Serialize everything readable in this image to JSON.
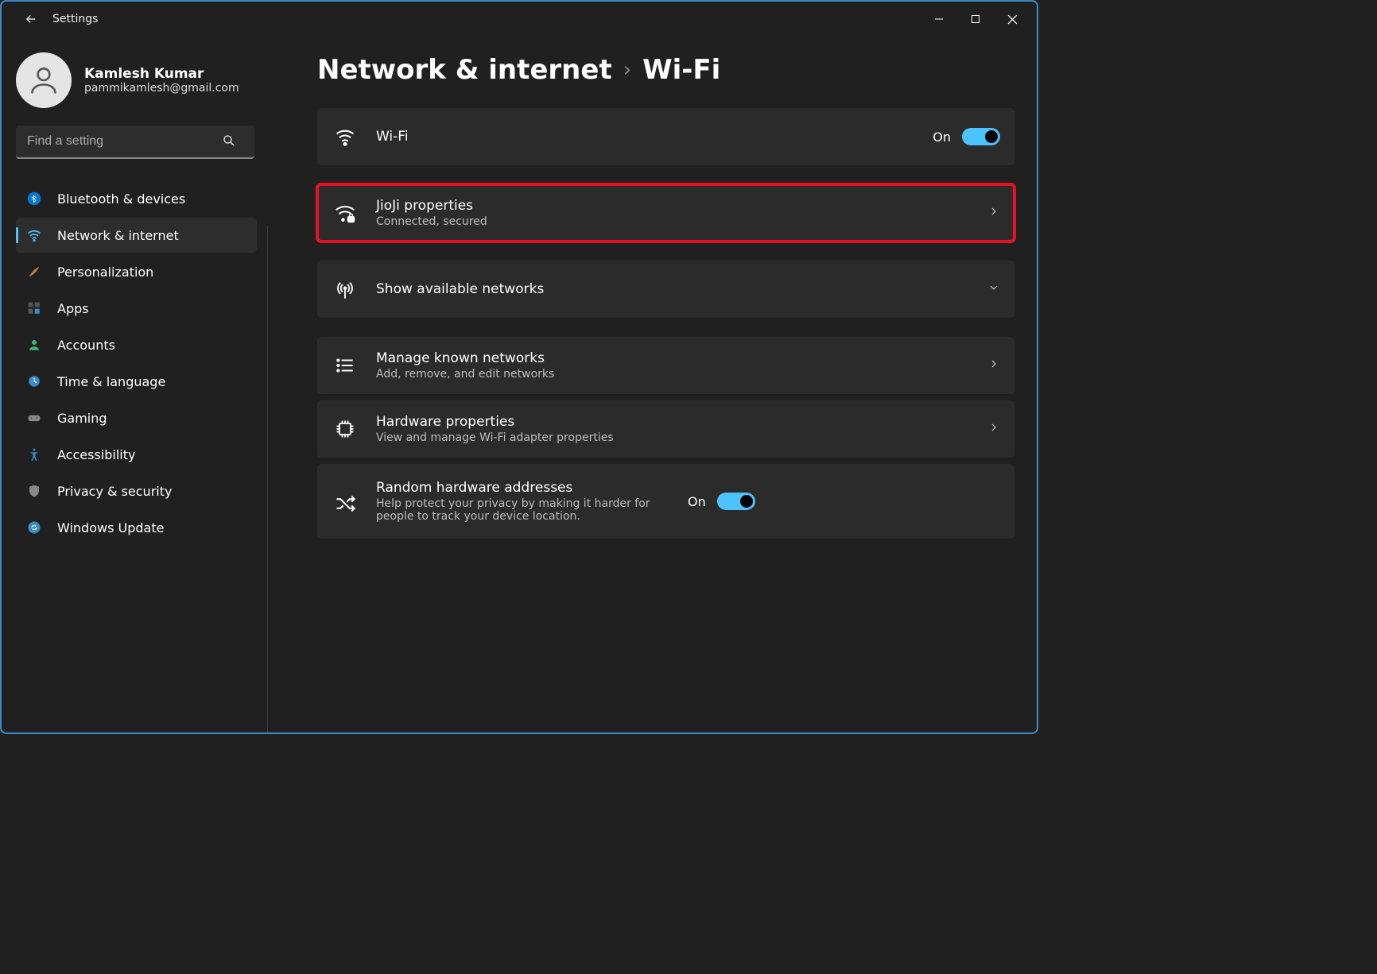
{
  "titlebar": {
    "app_title": "Settings"
  },
  "profile": {
    "name": "Kamlesh Kumar",
    "email": "pammikamlesh@gmail.com"
  },
  "search": {
    "placeholder": "Find a setting"
  },
  "nav": {
    "items": [
      {
        "label": "Bluetooth & devices"
      },
      {
        "label": "Network & internet"
      },
      {
        "label": "Personalization"
      },
      {
        "label": "Apps"
      },
      {
        "label": "Accounts"
      },
      {
        "label": "Time & language"
      },
      {
        "label": "Gaming"
      },
      {
        "label": "Accessibility"
      },
      {
        "label": "Privacy & security"
      },
      {
        "label": "Windows Update"
      }
    ],
    "active_index": 1
  },
  "breadcrumb": {
    "parent": "Network & internet",
    "sep": "›",
    "current": "Wi-Fi"
  },
  "cards": {
    "wifi": {
      "title": "Wi-Fi",
      "state_label": "On"
    },
    "properties": {
      "title": "JioJi properties",
      "sub": "Connected, secured"
    },
    "available": {
      "title": "Show available networks"
    },
    "manage": {
      "title": "Manage known networks",
      "sub": "Add, remove, and edit networks"
    },
    "hardware": {
      "title": "Hardware properties",
      "sub": "View and manage Wi-Fi adapter properties"
    },
    "random": {
      "title": "Random hardware addresses",
      "sub": "Help protect your privacy by making it harder for people to track your device location.",
      "state_label": "On"
    }
  }
}
